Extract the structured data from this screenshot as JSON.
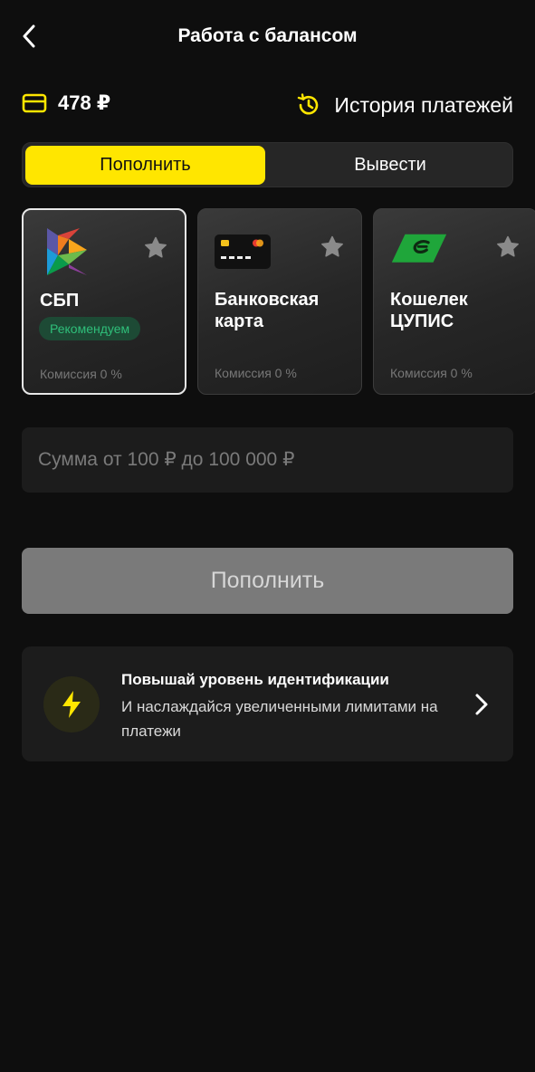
{
  "header": {
    "title": "Работа с балансом"
  },
  "balance": {
    "amount": "478 ₽",
    "history_label": "История платежей"
  },
  "tabs": {
    "deposit": "Пополнить",
    "withdraw": "Вывести",
    "active": "deposit"
  },
  "methods": [
    {
      "name": "СБП",
      "badge": "Рекомендуем",
      "commission": "Комиссия 0 %",
      "selected": true
    },
    {
      "name": "Банковская карта",
      "commission": "Комиссия 0 %",
      "selected": false
    },
    {
      "name": "Кошелек ЦУПИС",
      "commission": "Комиссия 0 %",
      "selected": false
    }
  ],
  "amount": {
    "placeholder": "Сумма от 100 ₽ до 100 000 ₽",
    "value": ""
  },
  "submit_label": "Пополнить",
  "promo": {
    "title": "Повышай уровень идентификации",
    "text": "И наслаждайся увеличенными лимитами на платежи"
  },
  "colors": {
    "accent": "#ffe600",
    "background": "#0e0e0e",
    "badge_text": "#2fbf7a",
    "badge_bg": "#1d4a35"
  }
}
